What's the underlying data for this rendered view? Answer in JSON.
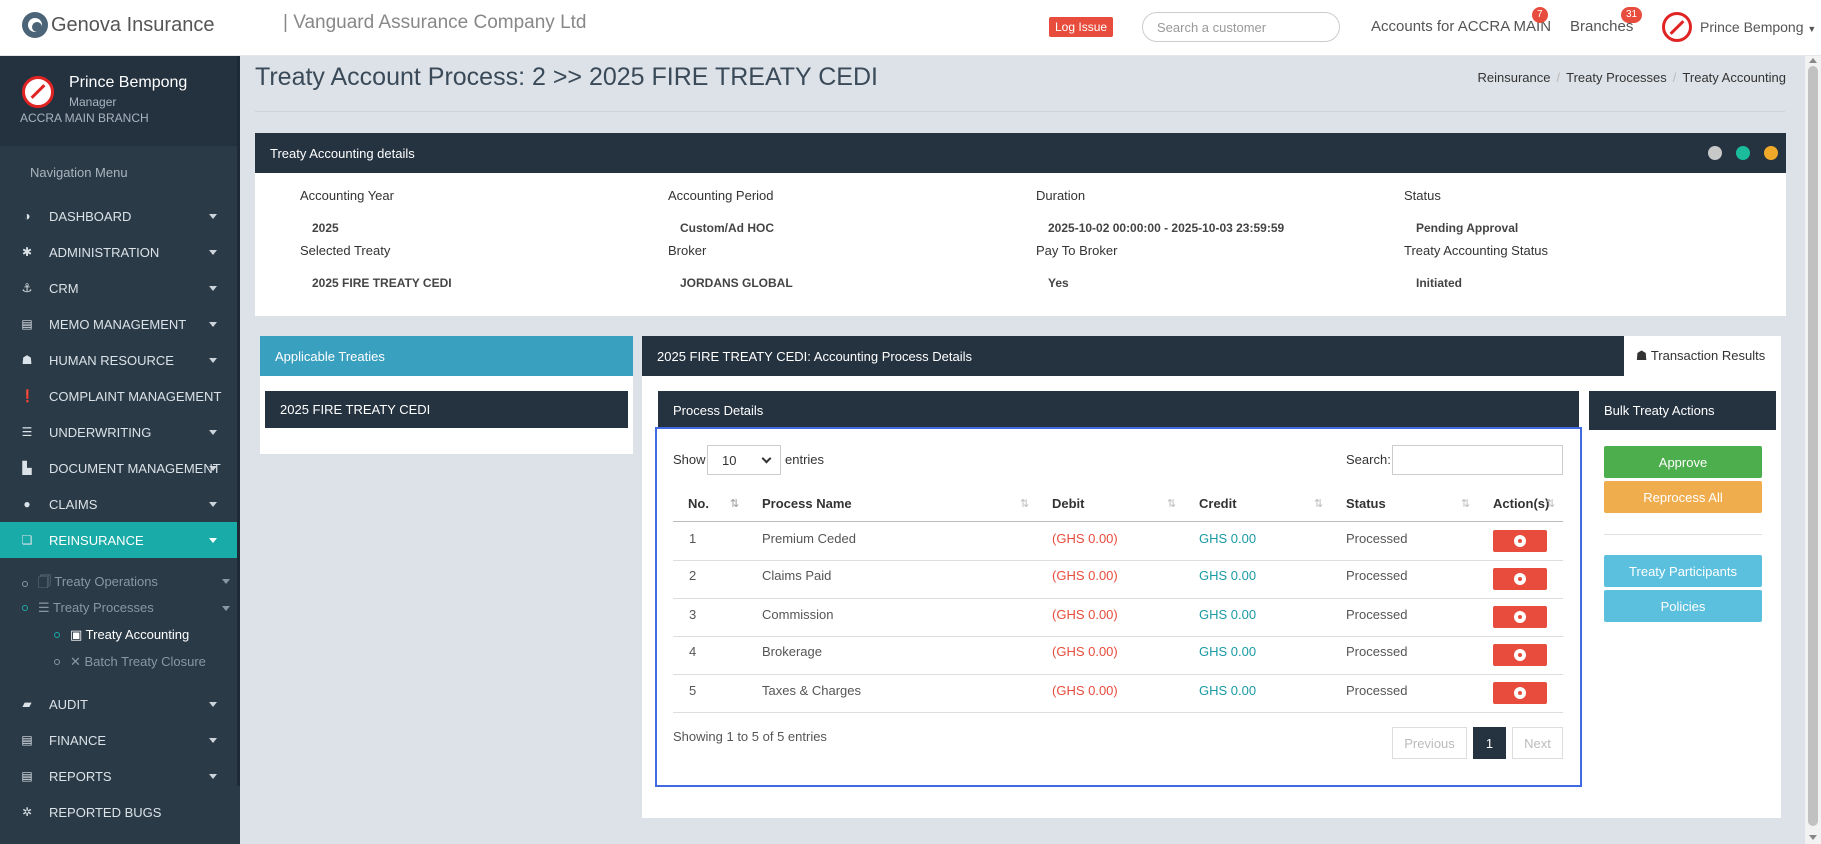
{
  "topbar": {
    "logo_text": "Genova Insurance",
    "company": "| Vanguard Assurance Company Ltd",
    "log_issue": "Log Issue",
    "search_placeholder": "Search a customer",
    "accounts_label": "Accounts for ACCRA MAIN",
    "accounts_badge": "7",
    "branches_label": "Branches",
    "branches_badge": "31",
    "user_name": "Prince Bempong"
  },
  "sidebar": {
    "profile_name": "Prince Bempong",
    "profile_role": "Manager",
    "profile_branch": "ACCRA MAIN BRANCH",
    "nav_title": "Navigation Menu",
    "items": [
      {
        "label": "DASHBOARD",
        "icon": "dashboard-icon",
        "glyph": "◑"
      },
      {
        "label": "ADMINISTRATION",
        "icon": "gear-icon",
        "glyph": "✱"
      },
      {
        "label": "CRM",
        "icon": "anchor-icon",
        "glyph": "⚓"
      },
      {
        "label": "MEMO MANAGEMENT",
        "icon": "memo-icon",
        "glyph": "▤"
      },
      {
        "label": "HUMAN RESOURCE",
        "icon": "users-icon",
        "glyph": "☗"
      },
      {
        "label": "COMPLAINT MANAGEMENT",
        "icon": "alert-icon",
        "glyph": "❗"
      },
      {
        "label": "UNDERWRITING",
        "icon": "list-icon",
        "glyph": "☰"
      },
      {
        "label": "DOCUMENT MANAGEMENT",
        "icon": "document-icon",
        "glyph": "▙"
      },
      {
        "label": "CLAIMS",
        "icon": "circle-icon",
        "glyph": "●"
      },
      {
        "label": "REINSURANCE",
        "icon": "reinsurance-icon",
        "glyph": "❏"
      }
    ],
    "sub_items": [
      {
        "label": "🗍 Treaty Operations"
      },
      {
        "label": "☰ Treaty Processes"
      },
      {
        "label": "▣ Treaty Accounting"
      },
      {
        "label": "✕ Batch Treaty Closure"
      }
    ],
    "bottom_items": [
      {
        "label": "AUDIT",
        "icon": "audit-icon",
        "glyph": "▰"
      },
      {
        "label": "FINANCE",
        "icon": "finance-icon",
        "glyph": "▤"
      },
      {
        "label": "REPORTS",
        "icon": "reports-icon",
        "glyph": "▤"
      },
      {
        "label": "REPORTED BUGS",
        "icon": "bug-icon",
        "glyph": "✲"
      }
    ]
  },
  "page": {
    "title": "Treaty Account Process: 2 >> 2025 FIRE TREATY CEDI",
    "breadcrumb": [
      "Reinsurance",
      "Treaty Processes",
      "Treaty Accounting"
    ]
  },
  "details": {
    "heading": "Treaty Accounting details",
    "fields": [
      {
        "label": "Accounting Year",
        "value": "2025"
      },
      {
        "label": "Accounting Period",
        "value": "Custom/Ad HOC"
      },
      {
        "label": "Duration",
        "value": "2025-10-02 00:00:00 - 2025-10-03  23:59:59"
      },
      {
        "label": "Status",
        "value": "Pending Approval"
      },
      {
        "label": "Selected Treaty",
        "value": "2025 FIRE TREATY CEDI"
      },
      {
        "label": "Broker",
        "value": "JORDANS GLOBAL"
      },
      {
        "label": "Pay To Broker",
        "value": "Yes"
      },
      {
        "label": "Treaty Accounting Status",
        "value": "Initiated"
      }
    ],
    "head_dot_colors": [
      "#c8c8c8",
      "#1abc9c",
      "#f1a92a"
    ]
  },
  "treaties": {
    "heading": "Applicable Treaties",
    "items": [
      "2025 FIRE TREATY CEDI"
    ]
  },
  "process": {
    "heading": "2025 FIRE TREATY CEDI: Accounting Process Details",
    "tab_label": "☗ Transaction Results",
    "inner_heading": "Process Details",
    "show_label": "Show",
    "entries_value": "10",
    "entries_label": "entries",
    "search_label": "Search:",
    "columns": [
      "No.",
      "Process Name",
      "Debit",
      "Credit",
      "Status",
      "Action(s)"
    ],
    "rows": [
      {
        "no": "1",
        "name": "Premium Ceded",
        "debit": "(GHS 0.00)",
        "credit": "GHS 0.00",
        "status": "Processed"
      },
      {
        "no": "2",
        "name": "Claims Paid",
        "debit": "(GHS 0.00)",
        "credit": "GHS 0.00",
        "status": "Processed"
      },
      {
        "no": "3",
        "name": "Commission",
        "debit": "(GHS 0.00)",
        "credit": "GHS 0.00",
        "status": "Processed"
      },
      {
        "no": "4",
        "name": "Brokerage",
        "debit": "(GHS 0.00)",
        "credit": "GHS 0.00",
        "status": "Processed"
      },
      {
        "no": "5",
        "name": "Taxes & Charges",
        "debit": "(GHS 0.00)",
        "credit": "GHS 0.00",
        "status": "Processed"
      }
    ],
    "showing": "Showing 1 to 5 of 5 entries",
    "pagination": {
      "previous": "Previous",
      "current": "1",
      "next": "Next"
    }
  },
  "bulk": {
    "heading": "Bulk Treaty Actions",
    "approve": "Approve",
    "reprocess": "Reprocess All",
    "participants": "Treaty Participants",
    "policies": "Policies",
    "colors": {
      "approve": "#4cae4c",
      "reprocess": "#f0ad4e",
      "info": "#5bc0de"
    }
  },
  "colors": {
    "accent": "#19aba7",
    "dark_header": "#253240",
    "danger": "#e74c3c"
  }
}
